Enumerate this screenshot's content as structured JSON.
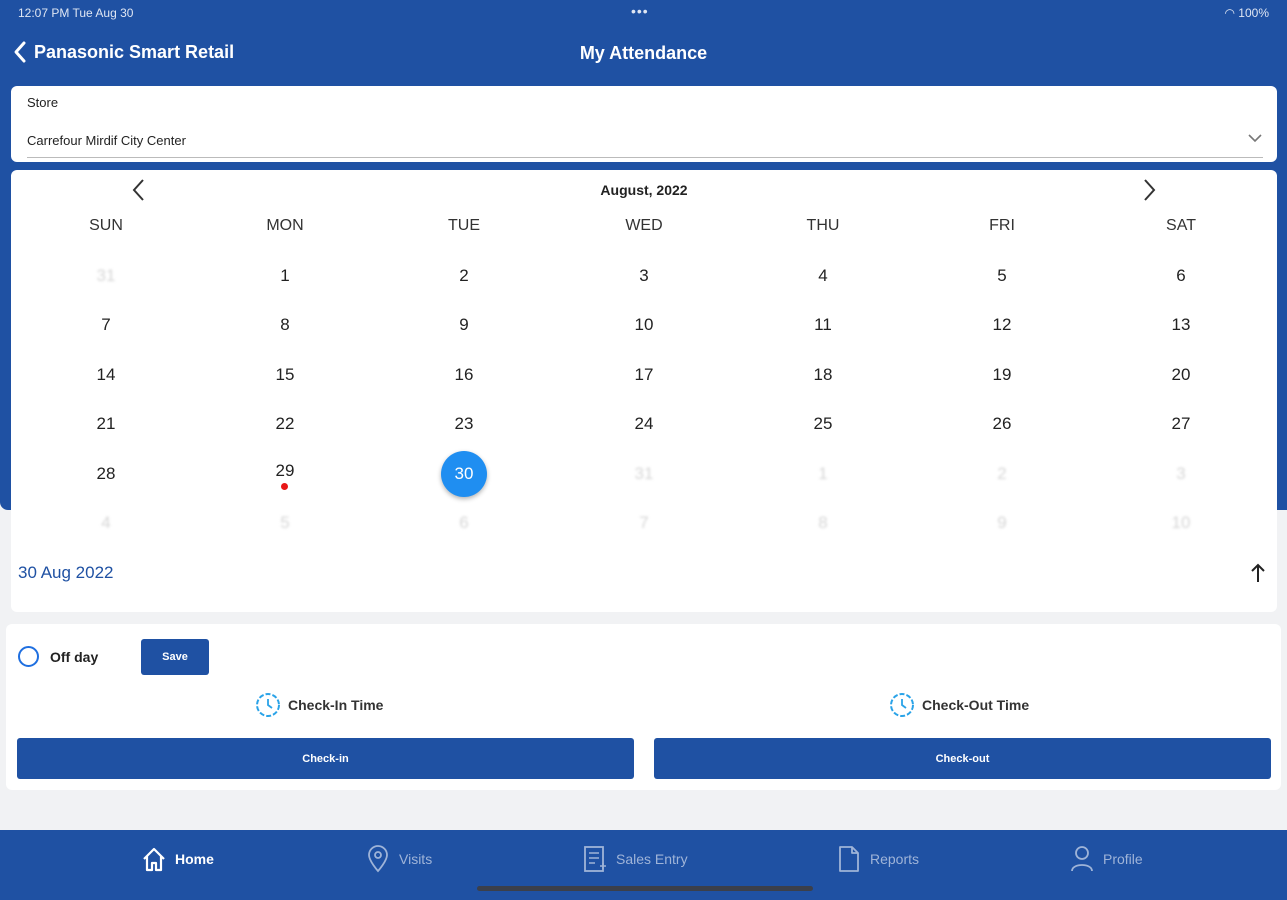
{
  "status": {
    "time": "12:07 PM   Tue Aug 30",
    "dots": "•••",
    "battery": "100%"
  },
  "header": {
    "back_label": "Panasonic Smart Retail",
    "title": "My Attendance"
  },
  "store": {
    "label": "Store",
    "value": "Carrefour Mirdif City Center"
  },
  "calendar": {
    "month_label": "August, 2022",
    "weekdays": [
      "SUN",
      "MON",
      "TUE",
      "WED",
      "THU",
      "FRI",
      "SAT"
    ],
    "weeks": [
      [
        "31",
        "1",
        "2",
        "3",
        "4",
        "5",
        "6"
      ],
      [
        "7",
        "8",
        "9",
        "10",
        "11",
        "12",
        "13"
      ],
      [
        "14",
        "15",
        "16",
        "17",
        "18",
        "19",
        "20"
      ],
      [
        "21",
        "22",
        "23",
        "24",
        "25",
        "26",
        "27"
      ],
      [
        "28",
        "29",
        "30",
        "31",
        "1",
        "2",
        "3"
      ],
      [
        "4",
        "5",
        "6",
        "7",
        "8",
        "9",
        "10"
      ]
    ],
    "selected_day": "30",
    "marked_day": "29",
    "selected_date_text": "30 Aug 2022"
  },
  "actions": {
    "offday_label": "Off day",
    "save_label": "Save",
    "checkin_time_label": "Check-In Time",
    "checkout_time_label": "Check-Out Time",
    "checkin_button": "Check-in",
    "checkout_button": "Check-out"
  },
  "tabs": [
    {
      "label": "Home",
      "icon": "home-icon",
      "active": true
    },
    {
      "label": "Visits",
      "icon": "location-pin-icon",
      "active": false
    },
    {
      "label": "Sales Entry",
      "icon": "sales-entry-icon",
      "active": false
    },
    {
      "label": "Reports",
      "icon": "document-icon",
      "active": false
    },
    {
      "label": "Profile",
      "icon": "user-icon",
      "active": false
    }
  ],
  "colors": {
    "brand": "#1f51a3",
    "selected_day": "#1f8ef1",
    "marker": "#e81717"
  }
}
